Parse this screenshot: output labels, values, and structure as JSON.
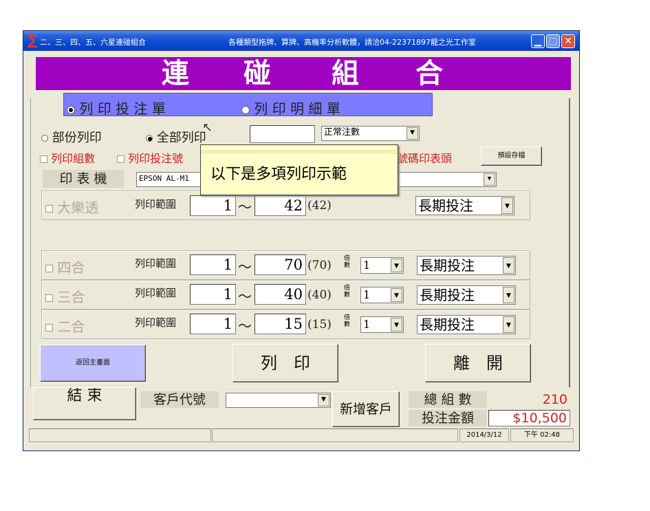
{
  "window": {
    "title": "二、三、四、五、六星連碰組合",
    "info": "各種類型拖牌、算牌、高機率分析軟體，請洽04-22371897龍之光工作室",
    "min": "▁",
    "max": "□",
    "close": "✕",
    "sigma": "∑"
  },
  "banner": {
    "c1": "連",
    "c2": "碰",
    "c3": "組",
    "c4": "合"
  },
  "print_mode": {
    "opt1": "列 印 投 注 單",
    "opt2": "列 印 明 細 單",
    "selected": "opt1"
  },
  "scope": {
    "opt1": "部份列印",
    "opt2": "全部列印",
    "input_value": "",
    "bet_type": "正常注數"
  },
  "options": {
    "cb1": "列印組數",
    "cb2": "列印投注號",
    "cb3": "號碼印表頭",
    "save_default": "預設存檔"
  },
  "printer": {
    "label": "印 表 機",
    "value": "EPSON AL-M1"
  },
  "tooltip": "以下是多項列印示範",
  "rows": [
    {
      "name": "大樂透",
      "range_label": "列印範圍",
      "from": "1",
      "to": "42",
      "total": "(42)",
      "mode": "長期投注",
      "has_mult": false
    },
    {
      "name": "四合",
      "range_label": "列印範圍",
      "from": "1",
      "to": "70",
      "total": "(70)",
      "mult_label": "倍數",
      "mult": "1",
      "mode": "長期投注",
      "has_mult": true
    },
    {
      "name": "三合",
      "range_label": "列印範圍",
      "from": "1",
      "to": "40",
      "total": "(40)",
      "mult_label": "倍數",
      "mult": "1",
      "mode": "長期投注",
      "has_mult": true
    },
    {
      "name": "二合",
      "range_label": "列印範圍",
      "from": "1",
      "to": "15",
      "total": "(15)",
      "mult_label": "倍數",
      "mult": "1",
      "mode": "長期投注",
      "has_mult": true
    }
  ],
  "tilde": "～",
  "buttons": {
    "back": "返回主畫面",
    "print": "列　印",
    "leave": "離　開",
    "end": "結 束",
    "new_customer": "新增客戶"
  },
  "customer": {
    "label": "客戶代號",
    "value": ""
  },
  "totals": {
    "groups_label": "總 組 數",
    "groups": "210",
    "amount_label": "投注金額",
    "amount": "$10,500"
  },
  "status": {
    "date": "2014/3/12",
    "time": "下午 02:48"
  },
  "colors": {
    "banner": "#a000c0",
    "radio_bar": "#7b7bff",
    "back_button": "#c0c0ff",
    "red": "#d02020",
    "title_bar": "#0a4ad0"
  }
}
